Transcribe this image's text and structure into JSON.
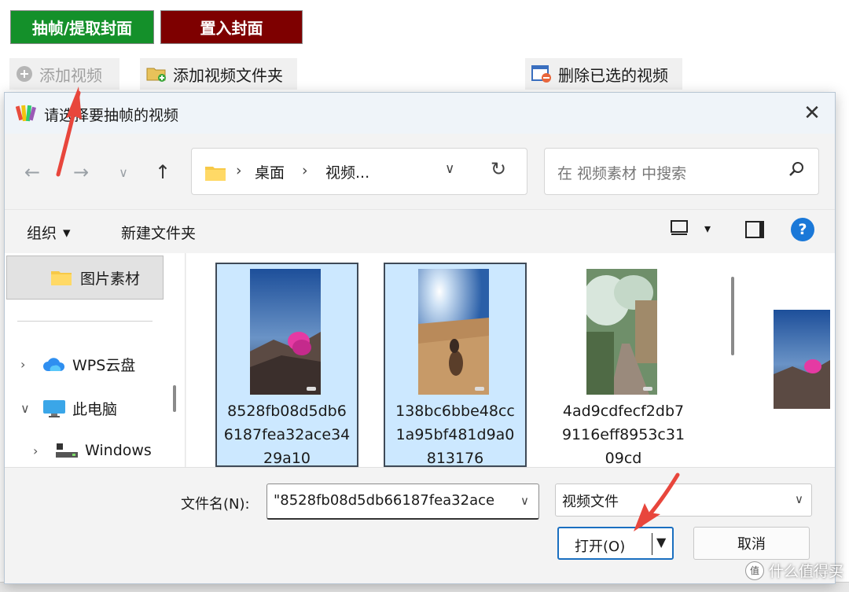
{
  "app": {
    "extract_cover_label": "抽帧/提取封面",
    "place_cover_label": "置入封面",
    "add_video_label": "添加视频",
    "add_folder_label": "添加视频文件夹",
    "delete_selected_label": "删除已选的视频"
  },
  "dialog": {
    "title": "请选择要抽帧的视频",
    "close_glyph": "✕",
    "breadcrumb": [
      "桌面",
      "视频..."
    ],
    "search_placeholder": "在 视频素材 中搜索",
    "toolbar": {
      "organize_label": "组织",
      "new_folder_label": "新建文件夹",
      "help_glyph": "?"
    },
    "nav_pane": {
      "selected_folder": "图片素材",
      "items": [
        {
          "label": "WPS云盘",
          "icon": "cloud-icon"
        },
        {
          "label": "此电脑",
          "icon": "monitor-icon"
        },
        {
          "label": "Windows",
          "icon": "drive-icon"
        }
      ]
    },
    "files": [
      {
        "name": "8528fb08d5db66187fea32ace3429a10",
        "selected": true
      },
      {
        "name": "138bc6bbe48cc1a95bf481d9a0813176",
        "selected": true
      },
      {
        "name": "4ad9cdfecf2db79116eff8953c3109cd",
        "selected": false
      }
    ],
    "filename_label": "文件名(N):",
    "filename_value": "\"8528fb08d5db66187fea32ace",
    "filetype_value": "视频文件",
    "open_label": "打开(O)",
    "cancel_label": "取消"
  },
  "watermark": {
    "text": "什么值得买",
    "logo_glyph": "值"
  },
  "colors": {
    "extract_bg": "#14902a",
    "place_bg": "#7e0000",
    "selection": "#cce8ff",
    "arrow": "#e8463c",
    "accent": "#1a6fc0"
  }
}
